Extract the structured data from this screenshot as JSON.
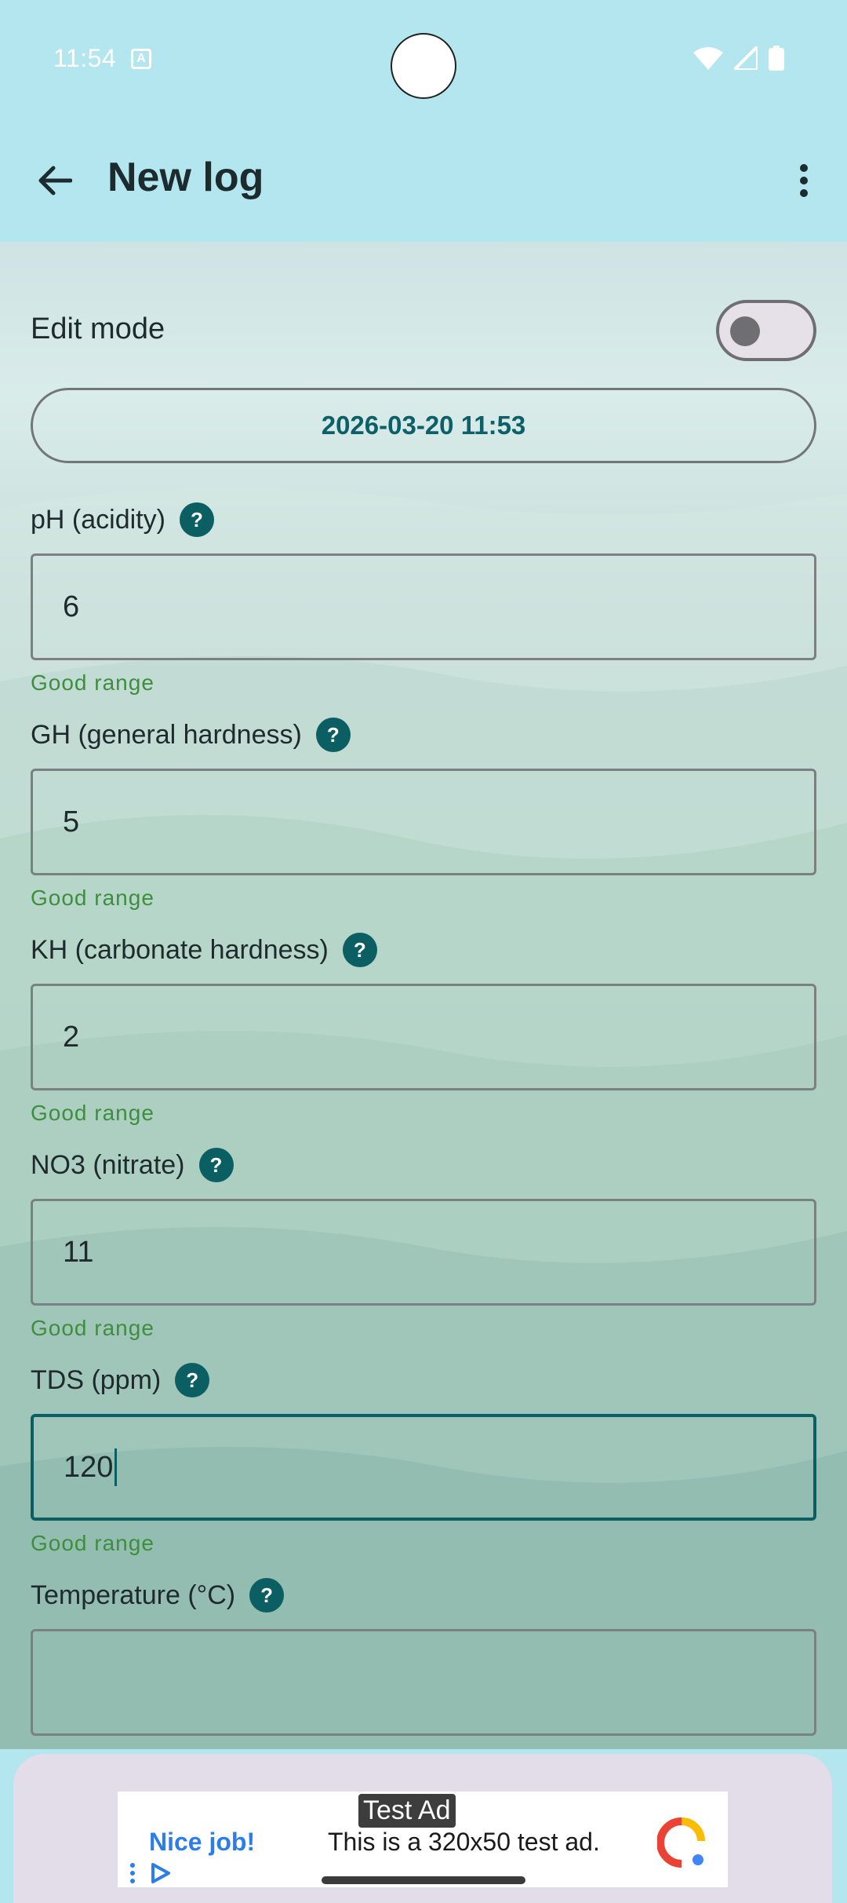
{
  "status_bar": {
    "time": "11:54",
    "notification_icon": "A"
  },
  "app_bar": {
    "title": "New log"
  },
  "edit_mode": {
    "label": "Edit mode",
    "enabled": false
  },
  "date_button": {
    "label": "2026-03-20 11:53"
  },
  "help_glyph": "?",
  "fields": [
    {
      "label": "pH (acidity)",
      "value": "6",
      "hint": "Good range"
    },
    {
      "label": "GH (general hardness)",
      "value": "5",
      "hint": "Good range"
    },
    {
      "label": "KH (carbonate hardness)",
      "value": "2",
      "hint": "Good range"
    },
    {
      "label": "NO3 (nitrate)",
      "value": "11",
      "hint": "Good range"
    },
    {
      "label": "TDS (ppm)",
      "value": "120",
      "hint": "Good range",
      "focused": true
    },
    {
      "label": "Temperature (°C)",
      "value": ""
    }
  ],
  "ad": {
    "tag": "Test Ad",
    "headline": "Nice job!",
    "body": "This is a 320x50 test ad."
  },
  "colors": {
    "accent": "#0b5f63",
    "app_bar": "#b3e6ee",
    "hint_green": "#3e8e3e"
  }
}
